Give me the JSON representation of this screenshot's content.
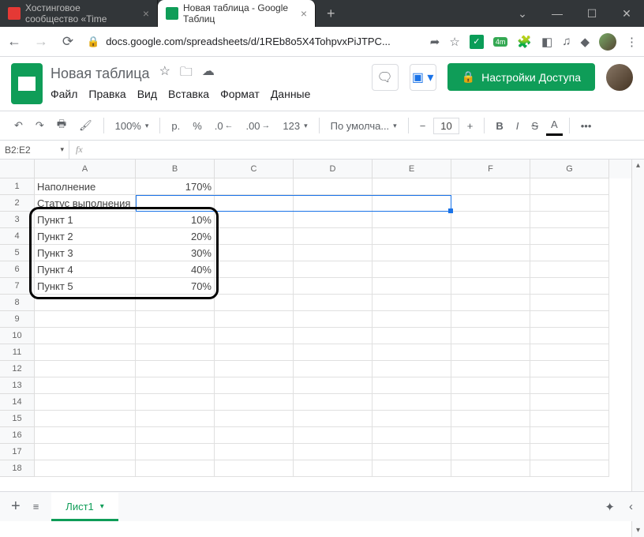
{
  "browser": {
    "tabs": [
      {
        "title": "Хостинговое сообщество «Time",
        "icon_color": "#e53935"
      },
      {
        "title": "Новая таблица - Google Таблиц",
        "icon_color": "#0f9d58"
      }
    ],
    "url_display": "docs.google.com/spreadsheets/d/1REb8o5X4TohpvxPiJTPC...",
    "ext_badge": "4m"
  },
  "doc": {
    "title": "Новая таблица",
    "menu": [
      "Файл",
      "Правка",
      "Вид",
      "Вставка",
      "Формат",
      "Данные"
    ],
    "share_label": "Настройки Доступа"
  },
  "toolbar": {
    "zoom": "100%",
    "currency": "р.",
    "percent": "%",
    "dec_dec": ".0",
    "dec_inc": ".00",
    "num_format": "123",
    "font": "По умолча...",
    "font_size": "10",
    "bold": "B",
    "italic": "I",
    "strike": "S",
    "color": "A",
    "more": "•••"
  },
  "namebox": "B2:E2",
  "columns": [
    "A",
    "B",
    "C",
    "D",
    "E",
    "F",
    "G"
  ],
  "rows": [
    {
      "n": "1",
      "a": "Наполнение",
      "b": "170%"
    },
    {
      "n": "2",
      "a": "Статус выполнения",
      "b": ""
    },
    {
      "n": "3",
      "a": "Пункт 1",
      "b": "10%"
    },
    {
      "n": "4",
      "a": "Пункт 2",
      "b": "20%"
    },
    {
      "n": "5",
      "a": "Пункт 3",
      "b": "30%"
    },
    {
      "n": "6",
      "a": "Пункт 4",
      "b": "40%"
    },
    {
      "n": "7",
      "a": "Пункт 5",
      "b": "70%"
    },
    {
      "n": "8"
    },
    {
      "n": "9"
    },
    {
      "n": "10"
    },
    {
      "n": "11"
    },
    {
      "n": "12"
    },
    {
      "n": "13"
    },
    {
      "n": "14"
    },
    {
      "n": "15"
    },
    {
      "n": "16"
    },
    {
      "n": "17"
    },
    {
      "n": "18"
    }
  ],
  "sheet_tab": "Лист1"
}
